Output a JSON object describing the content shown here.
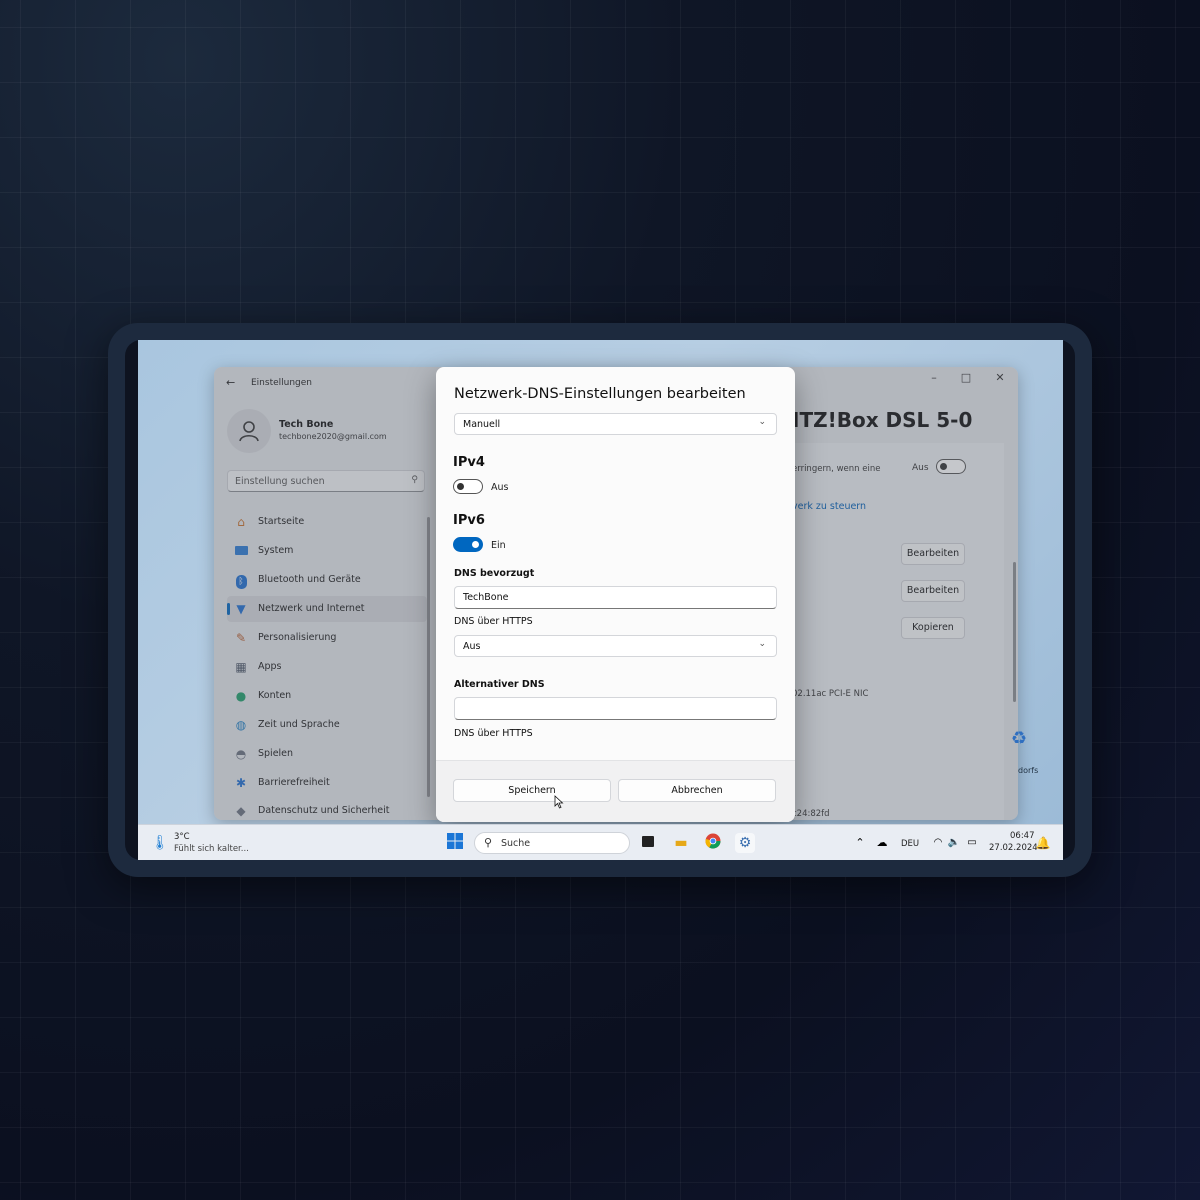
{
  "settings": {
    "app_title": "Einstellungen",
    "user_name": "Tech Bone",
    "user_email": "techbone2020@gmail.com",
    "search_placeholder": "Einstellung suchen",
    "nav": [
      {
        "label": "Startseite",
        "icon": "home-icon"
      },
      {
        "label": "System",
        "icon": "monitor-icon"
      },
      {
        "label": "Bluetooth und Geräte",
        "icon": "bluetooth-icon"
      },
      {
        "label": "Netzwerk und Internet",
        "icon": "wifi-icon",
        "active": true
      },
      {
        "label": "Personalisierung",
        "icon": "brush-icon"
      },
      {
        "label": "Apps",
        "icon": "apps-icon"
      },
      {
        "label": "Konten",
        "icon": "person-icon"
      },
      {
        "label": "Zeit und Sprache",
        "icon": "globe-icon"
      },
      {
        "label": "Spielen",
        "icon": "gamepad-icon"
      },
      {
        "label": "Barrierefreiheit",
        "icon": "accessibility-icon"
      },
      {
        "label": "Datenschutz und Sicherheit",
        "icon": "shield-icon"
      }
    ],
    "right": {
      "title_partial": "ITZ!Box DSL 5-0",
      "metered_text_partial": "erringern, wenn eine",
      "metered_toggle_label": "Aus",
      "link_partial": "verk zu steuern",
      "button_edit_1": "Bearbeiten",
      "button_edit_2": "Bearbeiten",
      "button_copy": "Kopieren",
      "adapter_partial": "02.11ac PCI-E NIC",
      "mac_partial": "c24:82fd",
      "desktop_icon_label": "dorfs"
    }
  },
  "dialog": {
    "title": "Netzwerk-DNS-Einstellungen bearbeiten",
    "mode_value": "Manuell",
    "ipv4": {
      "heading": "IPv4",
      "toggle_label": "Aus",
      "on": false
    },
    "ipv6": {
      "heading": "IPv6",
      "toggle_label": "Ein",
      "on": true,
      "preferred_label": "DNS bevorzugt",
      "preferred_value": "TechBone",
      "https_label": "DNS über HTTPS",
      "https_value": "Aus",
      "alternate_label": "Alternativer DNS",
      "alternate_value": "",
      "alternate_https_label": "DNS über HTTPS"
    },
    "save_label": "Speichern",
    "cancel_label": "Abbrechen"
  },
  "taskbar": {
    "weather_temp": "3°C",
    "weather_desc": "Fühlt sich kalter...",
    "search_label": "Suche",
    "language": "DEU",
    "time": "06:47",
    "date": "27.02.2024"
  },
  "colors": {
    "accent": "#0067c0",
    "background": "#0b1020",
    "device_frame": "#1d2a3e"
  }
}
